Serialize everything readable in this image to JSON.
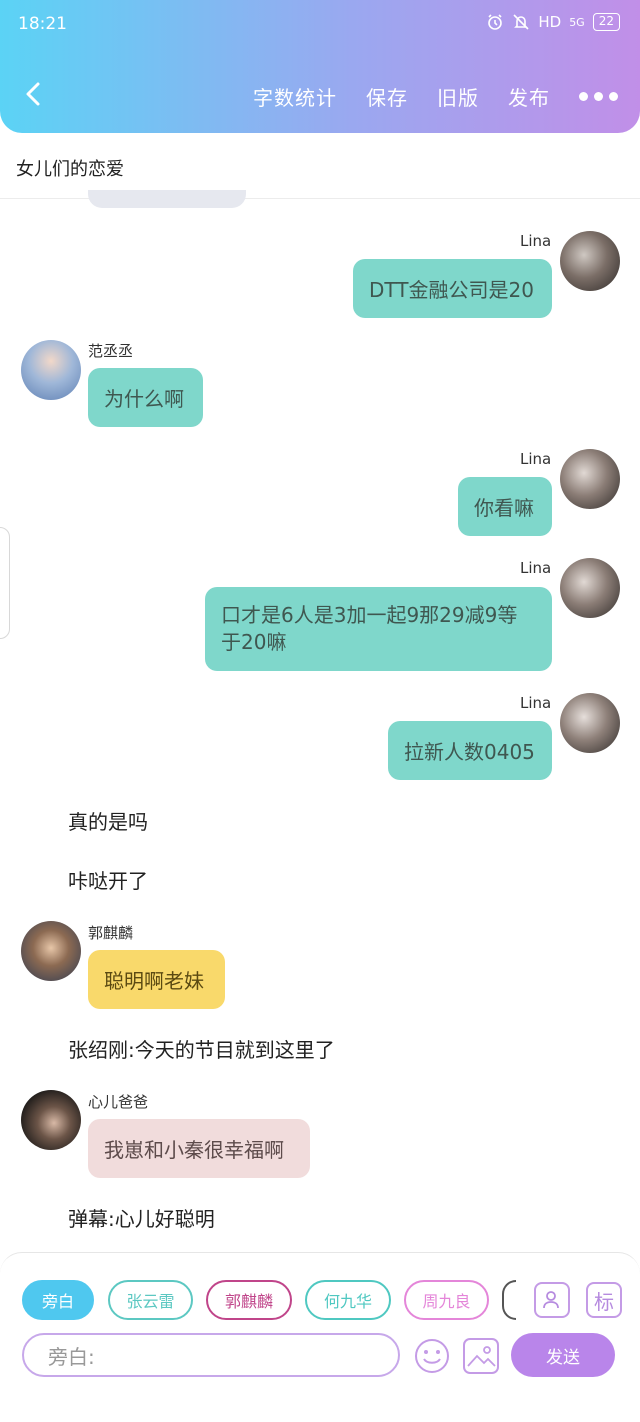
{
  "status_bar": {
    "time": "18:21",
    "network": "HD",
    "signal": "5G",
    "battery": "22"
  },
  "header": {
    "actions": [
      "字数统计",
      "保存",
      "旧版",
      "发布"
    ]
  },
  "title": "女儿们的恋爱",
  "messages": [
    {
      "name": "Lina",
      "text": "DTT金融公司是20"
    },
    {
      "name": "范丞丞",
      "text": "为什么啊"
    },
    {
      "name": "Lina",
      "text": "你看嘛"
    },
    {
      "name": "Lina",
      "text": "口才是6人是3加一起9那29减9等于20嘛"
    },
    {
      "name": "Lina",
      "text": "拉新人数0405"
    },
    {
      "text": "真的是吗"
    },
    {
      "text": "咔哒开了"
    },
    {
      "name": "郭麒麟",
      "text": "聪明啊老妹"
    },
    {
      "text": "张绍刚:今天的节目就到这里了"
    },
    {
      "name": "心儿爸爸",
      "text": "我崽和小秦很幸福啊"
    },
    {
      "text": "弹幕:心儿好聪明"
    }
  ],
  "chips": [
    "旁白",
    "张云雷",
    "郭麒麟",
    "何九华",
    "周九良"
  ],
  "chip_colors": [
    "#4fc8ef",
    "#5cc8c2",
    "#c0458a",
    "#4fc8c1",
    "#e486d9"
  ],
  "tag_button_label": "标",
  "input": {
    "placeholder": "旁白:"
  },
  "send_label": "发送",
  "colors": {
    "accent": "#b985ea",
    "teal_bubble": "#7fd7cb",
    "yellow_bubble": "#f9d96b",
    "pink_bubble": "#f1dcdc"
  }
}
